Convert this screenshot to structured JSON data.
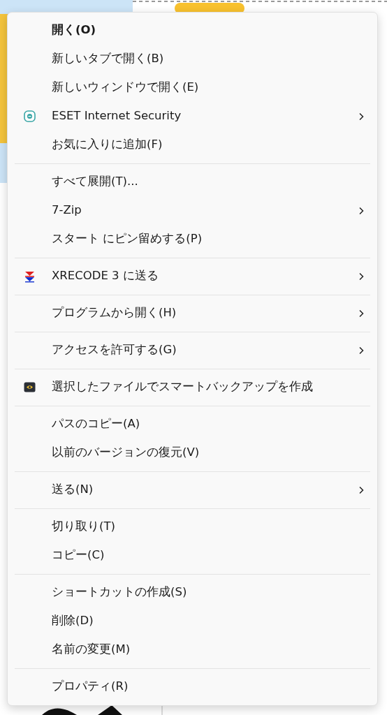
{
  "context_menu": {
    "groups": [
      [
        {
          "label": "開く(O)",
          "default": true,
          "submenu": false
        },
        {
          "label": "新しいタブで開く(B)",
          "default": false,
          "submenu": false
        },
        {
          "label": "新しいウィンドウで開く(E)",
          "default": false,
          "submenu": false
        },
        {
          "label": "ESET Internet Security",
          "default": false,
          "submenu": true,
          "kind": "eset"
        },
        {
          "label": "お気に入りに追加(F)",
          "default": false,
          "submenu": false
        }
      ],
      [
        {
          "label": "すべて展開(T)...",
          "default": false,
          "submenu": false
        },
        {
          "label": "7-Zip",
          "default": false,
          "submenu": true
        },
        {
          "label": "スタート にピン留めする(P)",
          "default": false,
          "submenu": false
        }
      ],
      [
        {
          "label": "XRECODE 3 に送る",
          "default": false,
          "submenu": true,
          "kind": "xrecode"
        }
      ],
      [
        {
          "label": "プログラムから開く(H)",
          "default": false,
          "submenu": true
        }
      ],
      [
        {
          "label": "アクセスを許可する(G)",
          "default": false,
          "submenu": true
        }
      ],
      [
        {
          "label": "選択したファイルでスマートバックアップを作成",
          "default": false,
          "submenu": false,
          "kind": "backup"
        }
      ],
      [
        {
          "label": "パスのコピー(A)",
          "default": false,
          "submenu": false
        },
        {
          "label": "以前のバージョンの復元(V)",
          "default": false,
          "submenu": false
        }
      ],
      [
        {
          "label": "送る(N)",
          "default": false,
          "submenu": true
        }
      ],
      [
        {
          "label": "切り取り(T)",
          "default": false,
          "submenu": false
        },
        {
          "label": "コピー(C)",
          "default": false,
          "submenu": false
        }
      ],
      [
        {
          "label": "ショートカットの作成(S)",
          "default": false,
          "submenu": false
        },
        {
          "label": "削除(D)",
          "default": false,
          "submenu": false
        },
        {
          "label": "名前の変更(M)",
          "default": false,
          "submenu": false
        }
      ],
      [
        {
          "label": "プロパティ(R)",
          "default": false,
          "submenu": false
        }
      ]
    ]
  }
}
